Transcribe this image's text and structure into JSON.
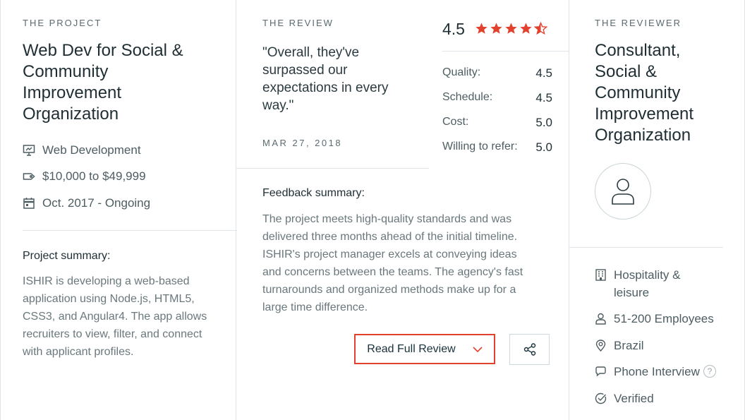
{
  "project": {
    "eyebrow": "THE PROJECT",
    "title_lines": [
      "Web Dev for Social &",
      "Community",
      "Improvement",
      "Organization"
    ],
    "service": "Web Development",
    "budget": "$10,000 to $49,999",
    "timeline": "Oct. 2017 - Ongoing",
    "summary_label": "Project summary:",
    "summary_lines": [
      "ISHIR is developing a web-based",
      "application using Node.js, HTML5,",
      "CSS3, and Angular4. The app allows",
      "recruiters to view, filter, and connect",
      "with applicant profiles."
    ]
  },
  "review": {
    "eyebrow": "THE REVIEW",
    "quote_lines": [
      "\"Overall, they've",
      "surpassed our",
      "expectations in every",
      "way.\""
    ],
    "date": "MAR 27, 2018",
    "overall_rating": "4.5",
    "stars_filled": 4.5,
    "scores": [
      {
        "label": "Quality:",
        "value": "4.5"
      },
      {
        "label": "Schedule:",
        "value": "4.5"
      },
      {
        "label": "Cost:",
        "value": "5.0"
      },
      {
        "label": "Willing to refer:",
        "value": "5.0"
      }
    ],
    "feedback_label": "Feedback summary:",
    "feedback_lines": [
      "The project meets high-quality standards and was",
      "delivered three months ahead of the initial timeline.",
      "ISHIR's project manager excels at conveying ideas",
      "and concerns between the teams. The agency's fast",
      "turnarounds and organized methods make up for a",
      "large time difference."
    ],
    "read_button": "Read Full Review"
  },
  "reviewer": {
    "eyebrow": "THE REVIEWER",
    "title_lines": [
      "Consultant,",
      "Social &",
      "Community",
      "Improvement",
      "Organization"
    ],
    "industry_lines": [
      "Hospitality &",
      "leisure"
    ],
    "employees": "51-200 Employees",
    "location": "Brazil",
    "interview": "Phone Interview",
    "help_mark": "?",
    "verified": "Verified"
  },
  "colors": {
    "accent": "#e2412e",
    "text_dark": "#1f2e33",
    "text_muted": "#6a787c",
    "border": "#dfe5e8"
  },
  "icons": {
    "service": "presentation-icon",
    "budget": "price-tag-icon",
    "timeline": "calendar-icon",
    "industry": "building-icon",
    "employees": "person-icon",
    "location": "map-pin-icon",
    "interview": "chat-bubble-icon",
    "verified": "check-circle-icon",
    "share": "share-icon",
    "dropdown": "chevron-down-icon"
  }
}
